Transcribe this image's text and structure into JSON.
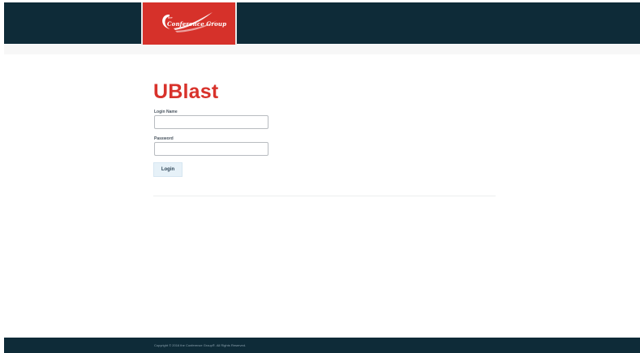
{
  "header": {
    "logo": {
      "prefix": "the",
      "name": "Conference Group"
    }
  },
  "main": {
    "title": "UBlast",
    "form": {
      "login_name_label": "Login Name",
      "login_name_value": "",
      "password_label": "Password",
      "password_value": "",
      "submit_label": "Login"
    }
  },
  "footer": {
    "copyright": "Copyright © 2016 the Conference Group®. All Rights Reserved."
  },
  "colors": {
    "header_bg": "#0e2b38",
    "brand_red": "#d6312a",
    "title_red": "#d8322b",
    "button_bg": "#e6f1f8"
  }
}
